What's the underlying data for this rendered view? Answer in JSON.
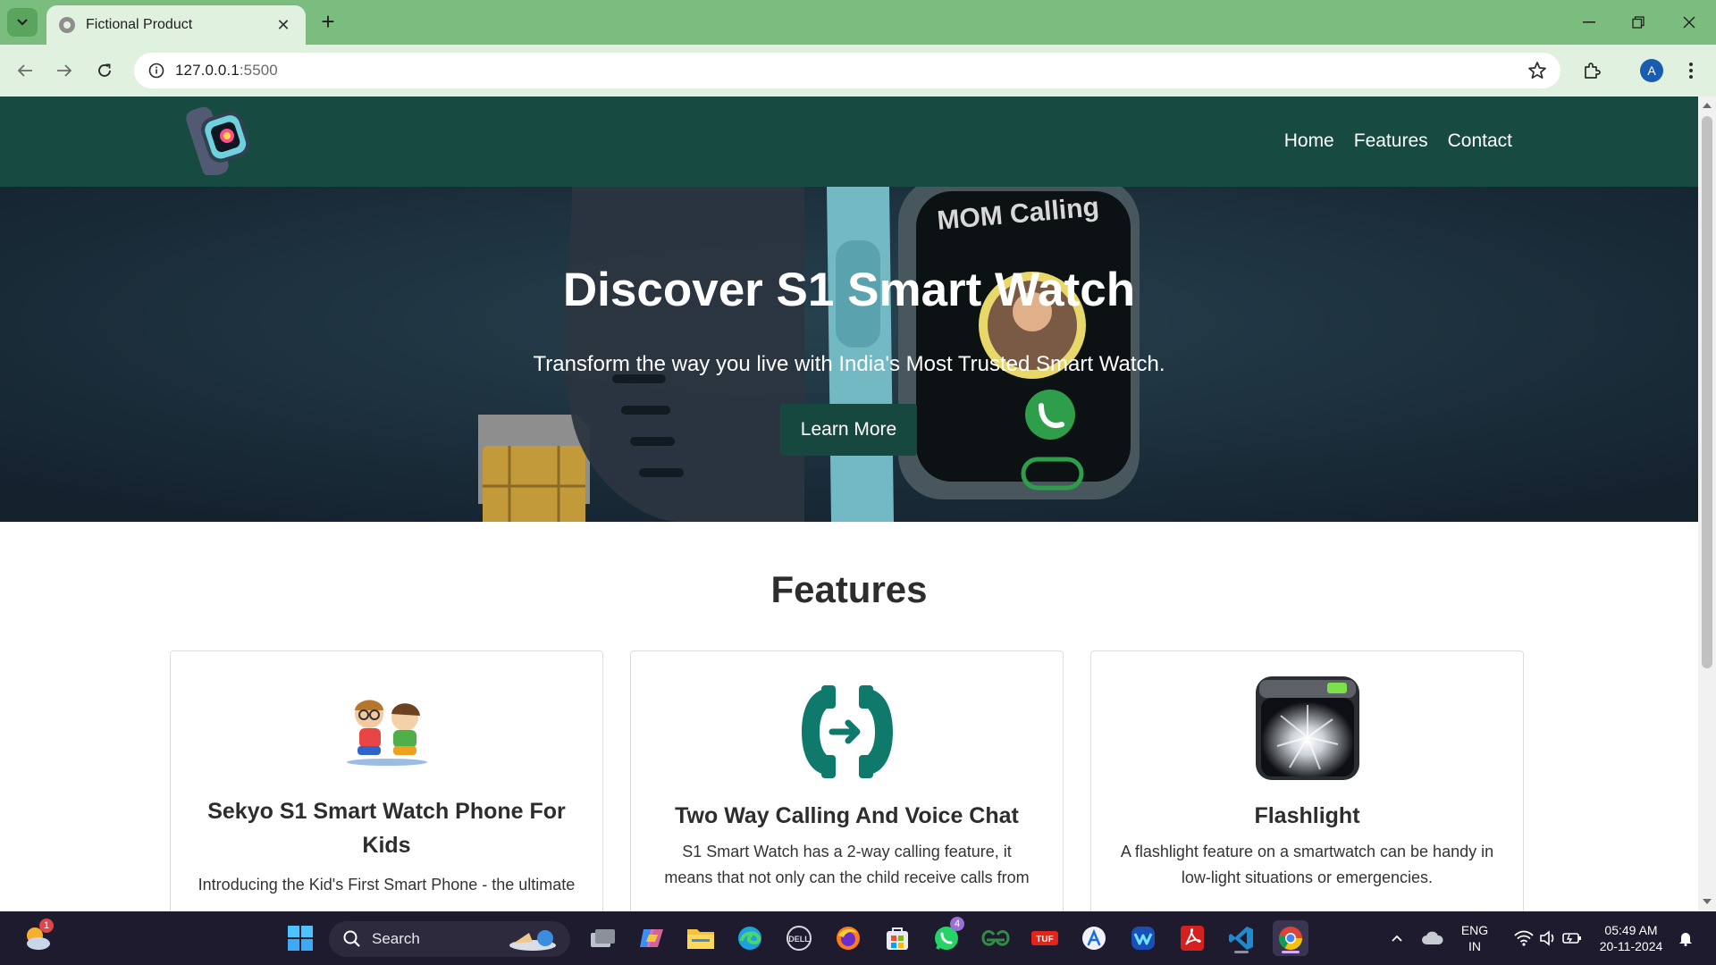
{
  "browser": {
    "tab_title": "Fictional Product",
    "new_tab": "+",
    "url_host": "127.0.0.1",
    "url_port": ":5500",
    "profile_initial": "A"
  },
  "site": {
    "nav": [
      "Home",
      "Features",
      "Contact"
    ],
    "hero": {
      "title": "Discover S1 Smart Watch",
      "subtitle": "Transform the way you live with India's Most Trusted Smart Watch.",
      "button": "Learn More",
      "bg_caller_text": "MOM Calling"
    },
    "features_title": "Features",
    "cards": [
      {
        "title": "Sekyo S1 Smart Watch Phone For Kids",
        "desc": "Introducing the Kid's First Smart Phone - the ultimate",
        "icon": "kids-icon"
      },
      {
        "title": "Two Way Calling And Voice Chat",
        "desc": "S1 Smart Watch has a 2-way calling feature, it means that not only can the child receive calls from",
        "icon": "two-way-call-icon"
      },
      {
        "title": "Flashlight",
        "desc": "A flashlight feature on a smartwatch can be handy in low-light situations or emergencies.",
        "icon": "flashlight-icon"
      }
    ]
  },
  "taskbar": {
    "search_label": "Search",
    "widgets_badge": "1",
    "whatsapp_badge": "4",
    "lang_line1": "ENG",
    "lang_line2": "IN",
    "time": "05:49 AM",
    "date": "20-11-2024"
  },
  "colors": {
    "tabbar": "#7bbd7e",
    "toolbar": "#e1f1e0",
    "site_header": "#174a40",
    "hero_button": "#17483f",
    "feature_icon_teal": "#0f7a6b"
  }
}
